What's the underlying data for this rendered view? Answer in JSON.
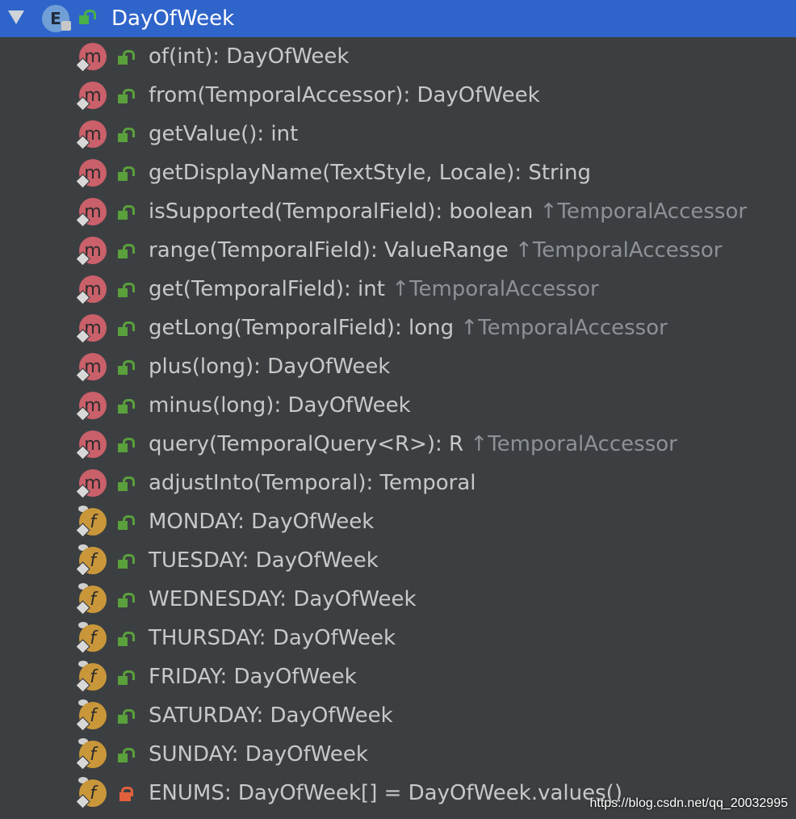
{
  "header": {
    "enum_letter": "E",
    "title": "DayOfWeek"
  },
  "members": [
    {
      "kind": "m",
      "access": "public",
      "text": "of(int): DayOfWeek",
      "origin": ""
    },
    {
      "kind": "m",
      "access": "public",
      "text": "from(TemporalAccessor): DayOfWeek",
      "origin": ""
    },
    {
      "kind": "m",
      "access": "public",
      "text": "getValue(): int",
      "origin": ""
    },
    {
      "kind": "m",
      "access": "public",
      "text": "getDisplayName(TextStyle, Locale): String",
      "origin": ""
    },
    {
      "kind": "m",
      "access": "public",
      "text": "isSupported(TemporalField): boolean",
      "origin": "↑TemporalAccessor"
    },
    {
      "kind": "m",
      "access": "public",
      "text": "range(TemporalField): ValueRange",
      "origin": "↑TemporalAccessor"
    },
    {
      "kind": "m",
      "access": "public",
      "text": "get(TemporalField): int",
      "origin": "↑TemporalAccessor"
    },
    {
      "kind": "m",
      "access": "public",
      "text": "getLong(TemporalField): long",
      "origin": "↑TemporalAccessor"
    },
    {
      "kind": "m",
      "access": "public",
      "text": "plus(long): DayOfWeek",
      "origin": ""
    },
    {
      "kind": "m",
      "access": "public",
      "text": "minus(long): DayOfWeek",
      "origin": ""
    },
    {
      "kind": "m",
      "access": "public",
      "text": "query(TemporalQuery<R>): R",
      "origin": "↑TemporalAccessor"
    },
    {
      "kind": "m",
      "access": "public",
      "text": "adjustInto(Temporal): Temporal",
      "origin": ""
    },
    {
      "kind": "f",
      "access": "public",
      "text": "MONDAY: DayOfWeek",
      "origin": ""
    },
    {
      "kind": "f",
      "access": "public",
      "text": "TUESDAY: DayOfWeek",
      "origin": ""
    },
    {
      "kind": "f",
      "access": "public",
      "text": "WEDNESDAY: DayOfWeek",
      "origin": ""
    },
    {
      "kind": "f",
      "access": "public",
      "text": "THURSDAY: DayOfWeek",
      "origin": ""
    },
    {
      "kind": "f",
      "access": "public",
      "text": "FRIDAY: DayOfWeek",
      "origin": ""
    },
    {
      "kind": "f",
      "access": "public",
      "text": "SATURDAY: DayOfWeek",
      "origin": ""
    },
    {
      "kind": "f",
      "access": "public",
      "text": "SUNDAY: DayOfWeek",
      "origin": ""
    },
    {
      "kind": "f",
      "access": "private",
      "text": "ENUMS: DayOfWeek[] = DayOfWeek.values()",
      "origin": ""
    }
  ],
  "watermark": "https://blog.csdn.net/qq_20032995",
  "colors": {
    "selection": "#2f65ca",
    "background": "#3c3f41",
    "method_badge": "#c9606a",
    "field_badge": "#c9973a",
    "public_lock": "#5aa03c",
    "private_lock": "#e0603c"
  }
}
